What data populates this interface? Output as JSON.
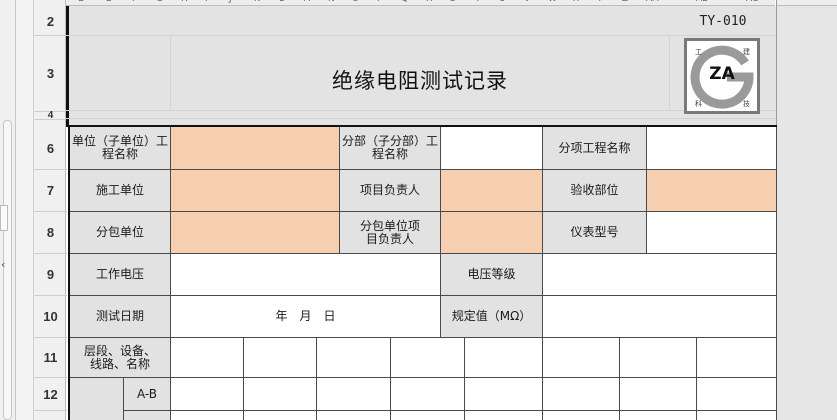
{
  "sheet": {
    "row_numbers": [
      "2",
      "3",
      "4",
      "6",
      "7",
      "8",
      "9",
      "10",
      "11",
      "12"
    ],
    "column_letters": [
      "D",
      "E",
      "F",
      "G",
      "H",
      "I",
      "J",
      "K",
      "L",
      "M",
      "N",
      "O",
      "P",
      "Q",
      "R",
      "S",
      "T",
      "U",
      "V",
      "W",
      "X",
      "Y",
      "Z",
      "AA",
      "AB",
      "AC"
    ]
  },
  "document": {
    "title": "绝缘电阻测试记录",
    "form_code": "TY-010",
    "logo_text": "ZA",
    "logo_corner_chars": [
      "工",
      "建",
      "科",
      "技"
    ]
  },
  "form": {
    "unit_project_label": "单位（子单位）工程名称",
    "division_label": "分部（子分部）工程名称",
    "subitem_label": "分项工程名称",
    "constructor_label": "施工单位",
    "project_manager_label": "项目负责人",
    "acceptance_label": "验收部位",
    "subcontractor_label": "分包单位",
    "subcontractor_manager_label": "分包单位项目负责人",
    "meter_model_label": "仪表型号",
    "working_voltage_label": "工作电压",
    "voltage_class_label": "电压等级",
    "test_date_label": "测试日期",
    "test_date_value": "年　月　日",
    "rated_value_label": "规定值（MΩ）",
    "layer_label": "层段、设备、线路、名称",
    "phase_ab_label": "A-B"
  },
  "colors": {
    "input_fill": "#f5cfaf",
    "label_fill": "#e2e2e2"
  }
}
